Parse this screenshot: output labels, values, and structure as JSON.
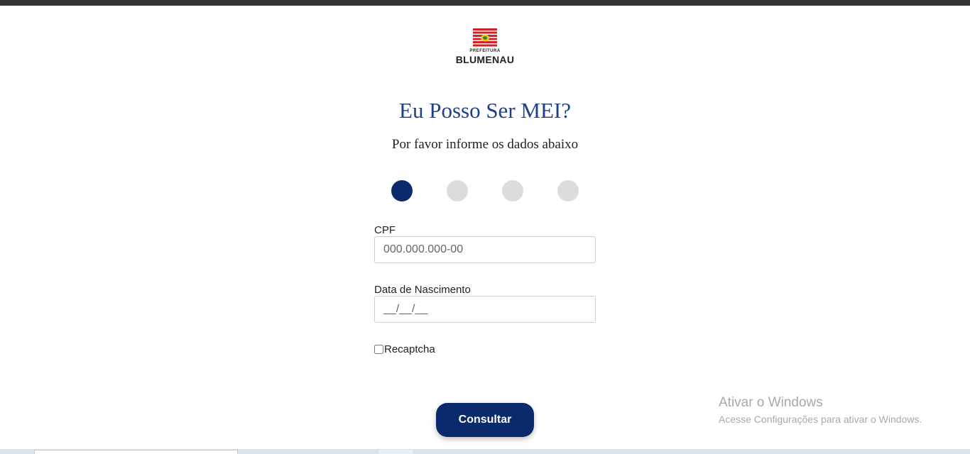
{
  "logo": {
    "top_text": "PREFEITURA",
    "bottom_text": "BLUMENAU"
  },
  "header": {
    "title": "Eu Posso Ser MEI?",
    "subtitle": "Por favor informe os dados abaixo"
  },
  "steps": {
    "count": 4,
    "active_index": 0
  },
  "form": {
    "cpf": {
      "label": "CPF",
      "placeholder": "000.000.000-00",
      "value": ""
    },
    "birthdate": {
      "label": "Data de Nascimento",
      "placeholder": "__/__/__",
      "value": ""
    },
    "recaptcha": {
      "label": "Recaptcha",
      "checked": false
    },
    "submit_label": "Consultar"
  },
  "watermark": {
    "title": "Ativar o Windows",
    "subtitle": "Acesse Configurações para ativar o Windows."
  },
  "colors": {
    "primary": "#0a2a6c",
    "title": "#1f3f8a",
    "step_inactive": "#dcdcdc",
    "top_bar": "#333333"
  }
}
